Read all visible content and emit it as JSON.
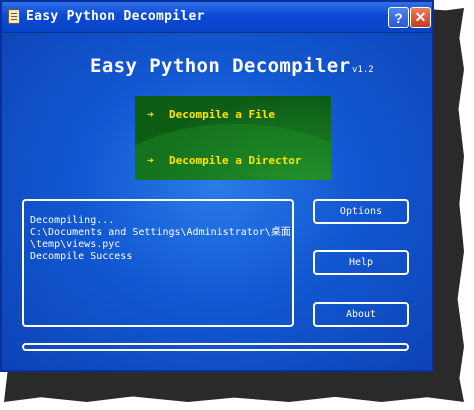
{
  "window": {
    "title": "Easy Python Decompiler",
    "help_glyph": "?",
    "close_glyph": "✕"
  },
  "header": {
    "app_name": "Easy Python Decompiler",
    "version": "v1.2"
  },
  "actions": [
    {
      "label": "Decompile a File",
      "icon": "arrow-right-icon"
    },
    {
      "label": "Decompile a Director",
      "icon": "arrow-right-icon"
    }
  ],
  "log": {
    "lines": [
      "Decompiling...",
      "C:\\Documents and Settings\\Administrator\\桌面",
      "\\temp\\views.pyc",
      "Decompile Success"
    ]
  },
  "buttons": {
    "options": "Options",
    "help": "Help",
    "about": "About"
  },
  "progress": {
    "value": 0
  },
  "colors": {
    "client_bg": "#1258d2",
    "panel_green": "#0d5d15",
    "action_text": "#ffe500",
    "text": "#ffffff"
  }
}
